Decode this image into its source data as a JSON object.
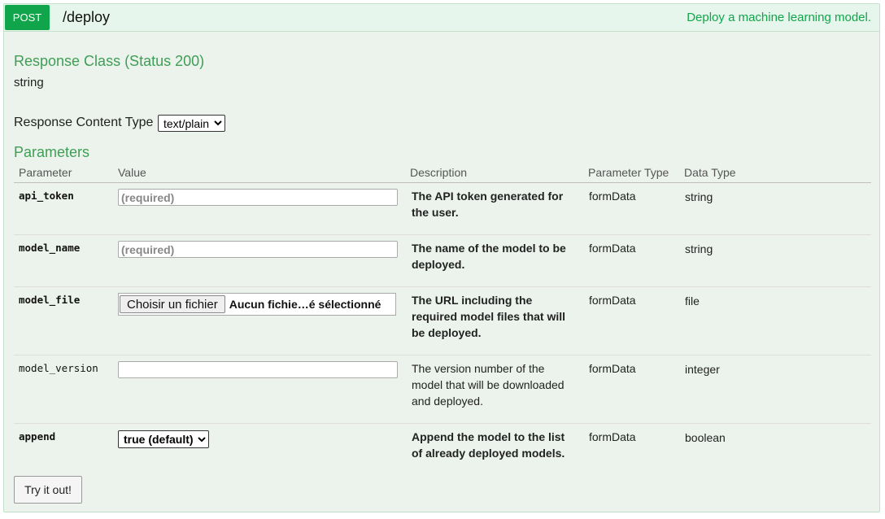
{
  "operation": {
    "method": "POST",
    "path": "/deploy",
    "summary": "Deploy a machine learning model."
  },
  "response": {
    "class_title": "Response Class (Status 200)",
    "class_type": "string",
    "content_type_label": "Response Content Type",
    "content_type_value": "text/plain"
  },
  "parameters": {
    "title": "Parameters",
    "headers": {
      "parameter": "Parameter",
      "value": "Value",
      "description": "Description",
      "parameter_type": "Parameter Type",
      "data_type": "Data Type"
    },
    "rows": [
      {
        "name": "api_token",
        "placeholder": "(required)",
        "description": "The API token generated for the user.",
        "param_type": "formData",
        "data_type": "string"
      },
      {
        "name": "model_name",
        "placeholder": "(required)",
        "description": "The name of the model to be deployed.",
        "param_type": "formData",
        "data_type": "string"
      },
      {
        "name": "model_file",
        "file_button": "Choisir un fichier",
        "file_status": "Aucun fichie…é sélectionné",
        "description": "The URL including the required model files that will be deployed.",
        "param_type": "formData",
        "data_type": "file"
      },
      {
        "name": "model_version",
        "placeholder": "",
        "description": "The version number of the model that will be downloaded and deployed.",
        "param_type": "formData",
        "data_type": "integer"
      },
      {
        "name": "append",
        "selected": "true (default)",
        "description": "Append the model to the list of already deployed models.",
        "param_type": "formData",
        "data_type": "boolean"
      }
    ]
  },
  "try_button": "Try it out!",
  "colors": {
    "accent_green": "#10a54a",
    "panel_bg": "#ebf3ec",
    "title_green": "#3f9e55"
  }
}
